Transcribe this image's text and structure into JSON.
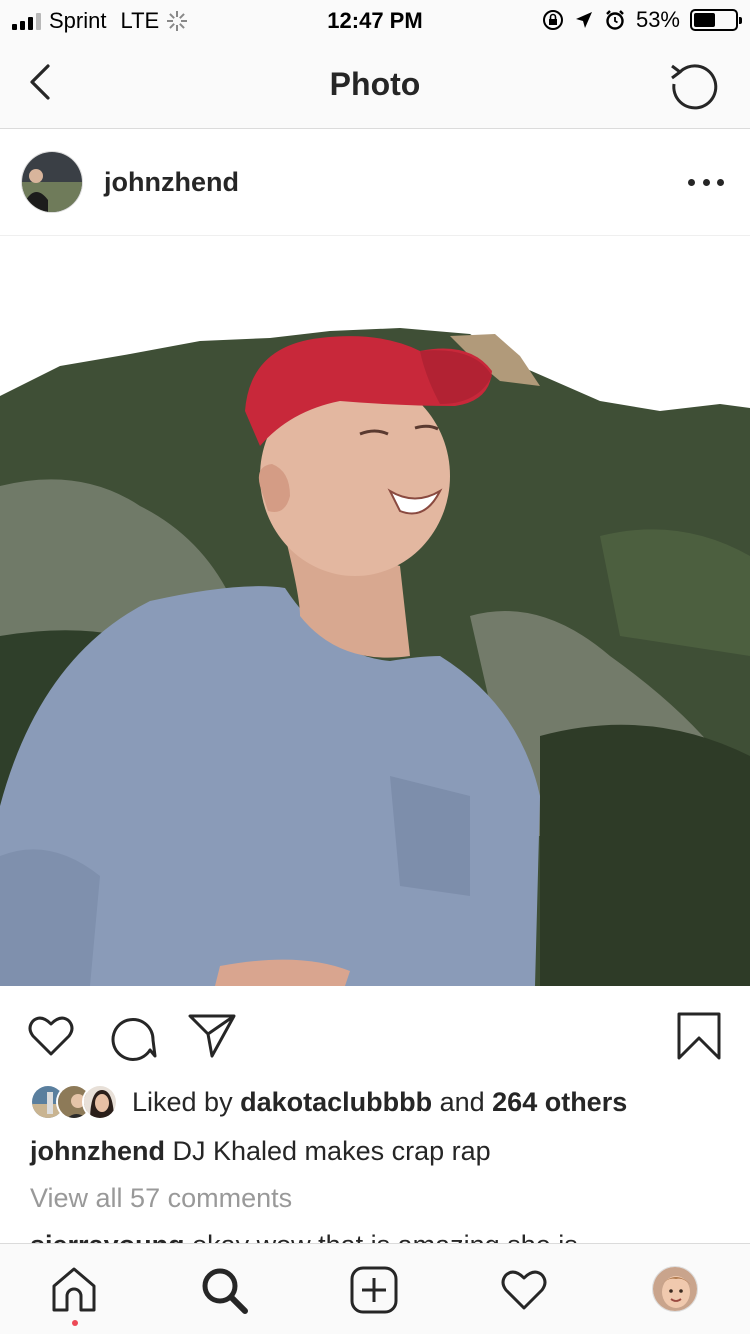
{
  "status_bar": {
    "carrier": "Sprint",
    "network": "LTE",
    "time": "12:47 PM",
    "battery": "53%",
    "battery_level": 0.53
  },
  "nav": {
    "title": "Photo",
    "back_icon": "chevron-left-icon",
    "refresh_icon": "refresh-icon"
  },
  "post": {
    "username": "johnzhend",
    "photo_description": "young man in red cap and gray long-sleeve shirt smiling in front of a forested mountain"
  },
  "actions": {
    "icons": [
      "heart-icon",
      "comment-icon",
      "share-icon",
      "bookmark-icon"
    ]
  },
  "likes": {
    "prefix": "Liked by ",
    "liker": "dakotaclubbbb",
    "middle": " and ",
    "others": "264 others"
  },
  "caption": {
    "username": "johnzhend",
    "text": " DJ Khaled makes crap rap"
  },
  "comments": {
    "view_all": "View all 57 comments",
    "peek_username": "sierrayoung",
    "peek_text": " okay wow that is amazing she is"
  },
  "tab_bar": {
    "icons": [
      "home-icon",
      "search-icon",
      "new-post-icon",
      "activity-icon",
      "profile-avatar"
    ]
  },
  "colors": {
    "text": "#262626",
    "muted": "#999999",
    "border": "#dbdbdb",
    "notification_dot": "#ed4956",
    "cap_red": "#c8283a",
    "shirt_gray": "#8a9bb8"
  }
}
